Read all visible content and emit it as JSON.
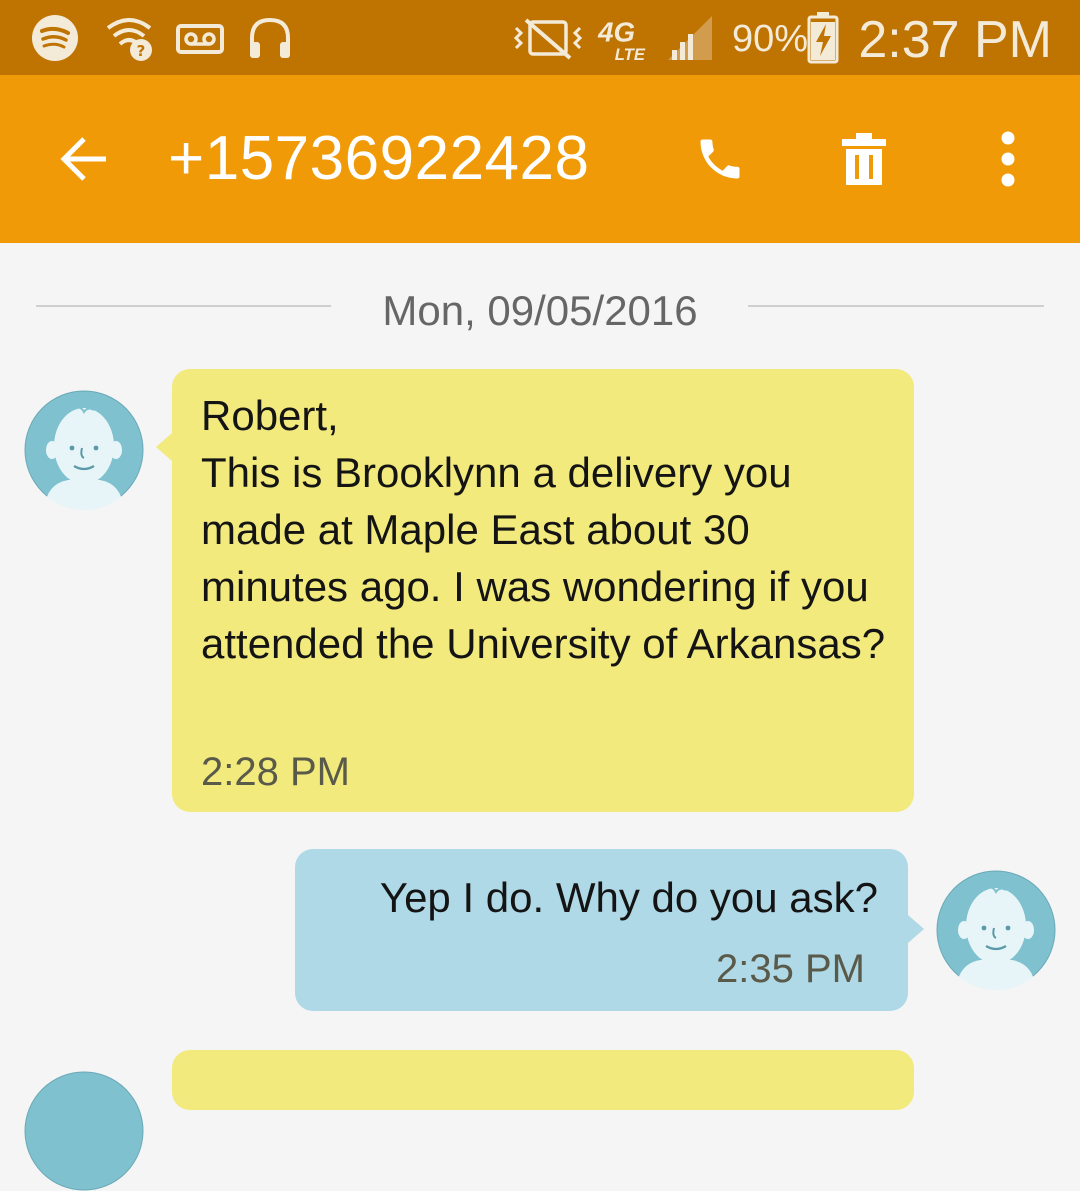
{
  "status_bar": {
    "battery": "90%",
    "time": "2:37 PM",
    "network": "4G LTE",
    "icons": [
      "spotify-icon",
      "wifi-question-icon",
      "voicemail-icon",
      "headphones-icon",
      "vibrate-mute-icon",
      "network-4g-lte-icon",
      "signal-icon",
      "battery-charging-icon"
    ]
  },
  "app_bar": {
    "title": "+15736922428",
    "back_icon": "back-arrow-icon",
    "call_icon": "phone-icon",
    "delete_icon": "trash-icon",
    "menu_icon": "more-vert-icon"
  },
  "conversation": {
    "date_divider": "Mon, 09/05/2016",
    "messages": [
      {
        "direction": "incoming",
        "text": "Robert,\nThis is Brooklynn a delivery you made at Maple East about 30 minutes ago. I was wondering if you attended the University of Arkansas?",
        "time": "2:28 PM"
      },
      {
        "direction": "outgoing",
        "text": "Yep I do. Why do you ask?",
        "time": "2:35 PM"
      },
      {
        "direction": "incoming",
        "text": "",
        "time": ""
      }
    ]
  },
  "colors": {
    "status_bar": "#bf7402",
    "app_bar": "#f09a08",
    "incoming_bubble": "#f2ea7c",
    "outgoing_bubble": "#afd9e6",
    "avatar_bg": "#7fc1cf"
  }
}
